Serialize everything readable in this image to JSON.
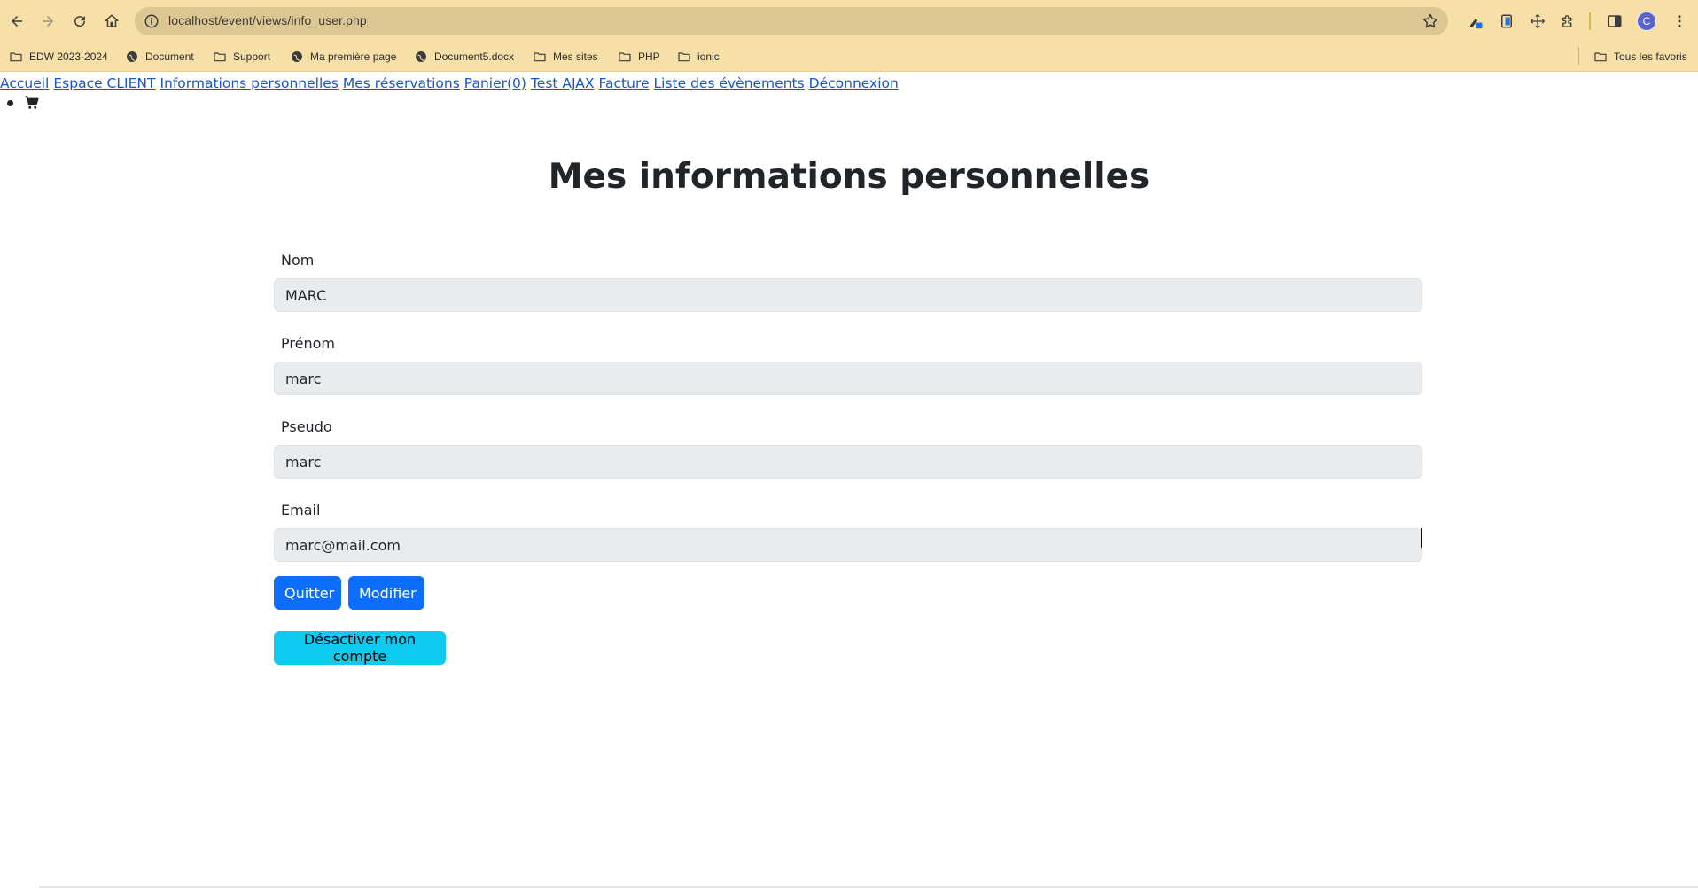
{
  "browser": {
    "url": "localhost/event/views/info_user.php",
    "profile_initial": "C",
    "bookmarks": [
      {
        "label": "EDW 2023-2024",
        "icon": "folder-icon"
      },
      {
        "label": "Document",
        "icon": "globe-icon"
      },
      {
        "label": "Support",
        "icon": "folder-icon"
      },
      {
        "label": "Ma première page",
        "icon": "globe-icon"
      },
      {
        "label": "Document5.docx",
        "icon": "globe-icon"
      },
      {
        "label": "Mes sites",
        "icon": "folder-icon"
      },
      {
        "label": "PHP",
        "icon": "folder-icon"
      },
      {
        "label": "ionic",
        "icon": "folder-icon"
      }
    ],
    "all_bookmarks_label": "Tous les favoris"
  },
  "nav": {
    "links": [
      "Accueil",
      "Espace CLIENT",
      "Informations personnelles",
      "Mes réservations",
      "Panier(0)",
      "Test AJAX",
      "Facture",
      "Liste des évènements",
      "Déconnexion"
    ],
    "cart_icon": "cart-icon"
  },
  "page": {
    "title": "Mes informations personnelles"
  },
  "form": {
    "nom": {
      "label": "Nom",
      "value": "MARC"
    },
    "prenom": {
      "label": "Prénom",
      "value": "marc"
    },
    "pseudo": {
      "label": "Pseudo",
      "value": "marc"
    },
    "email": {
      "label": "Email",
      "value": "marc@mail.com"
    }
  },
  "actions": {
    "quit_label": "Quitter",
    "edit_label": "Modifier",
    "deactivate_label": "Désactiver mon compte"
  },
  "colors": {
    "primary": "#0d6efd",
    "info": "#0dcaf0",
    "chrome": "#f6e0a8",
    "link": "#1a56c4"
  }
}
